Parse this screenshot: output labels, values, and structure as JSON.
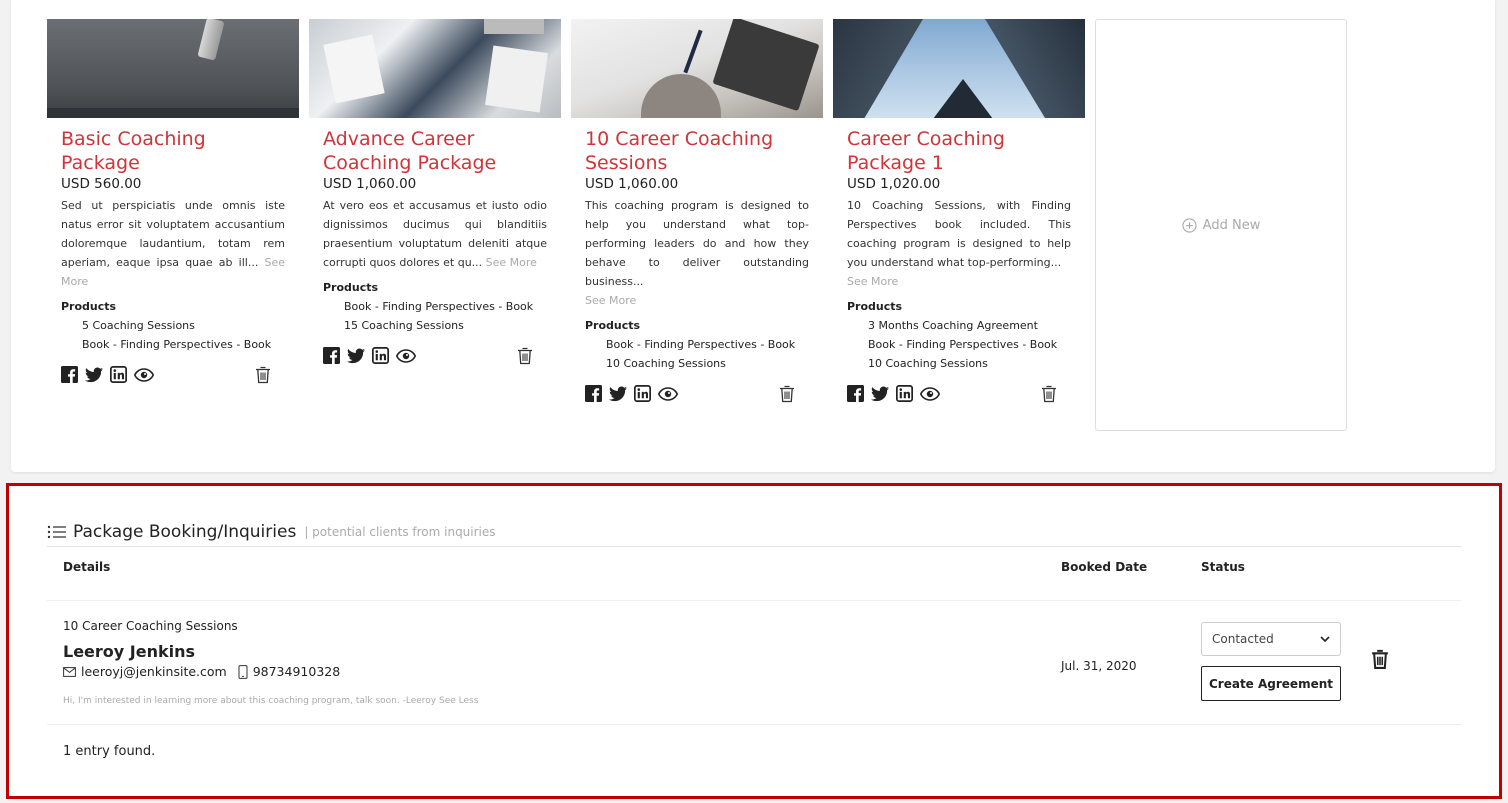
{
  "packages": [
    {
      "title": "Basic Coaching Package",
      "price": "USD 560.00",
      "description": "Sed ut perspiciatis unde omnis iste natus error sit voluptatem accusantium doloremque laudantium, totam rem aperiam, eaque ipsa quae ab ill...",
      "see_more": "See More",
      "products_heading": "Products",
      "products": [
        "5 Coaching Sessions",
        "Book - Finding Perspectives - Book"
      ]
    },
    {
      "title": "Advance Career Coaching Package",
      "price": "USD 1,060.00",
      "description": "At vero eos et accusamus et iusto odio dignissimos ducimus qui blanditiis praesentium voluptatum deleniti atque corrupti quos dolores et qu...",
      "see_more": "See More",
      "products_heading": "Products",
      "products": [
        "Book - Finding Perspectives - Book",
        "15 Coaching Sessions"
      ]
    },
    {
      "title": "10 Career Coaching Sessions",
      "price": "USD 1,060.00",
      "description": "This coaching program is designed to help you understand what top-performing leaders do and how they behave to deliver outstanding business...",
      "see_more": "See More",
      "products_heading": "Products",
      "products": [
        "Book - Finding Perspectives - Book",
        "10 Coaching Sessions"
      ]
    },
    {
      "title": "Career Coaching Package 1",
      "price": "USD 1,020.00",
      "description": "10 Coaching Sessions, with Finding Perspectives book included. This coaching program is designed to help you understand what top-performing...",
      "see_more": "See More",
      "products_heading": "Products",
      "products": [
        "3 Months Coaching Agreement",
        "Book - Finding Perspectives - Book",
        "10 Coaching Sessions"
      ]
    }
  ],
  "add_new_label": "Add New",
  "booking": {
    "title": "Package Booking/Inquiries",
    "subtitle": "| potential clients from inquiries",
    "columns": {
      "details": "Details",
      "booked_date": "Booked Date",
      "status": "Status"
    },
    "row": {
      "package": "10 Career Coaching Sessions",
      "client_name": "Leeroy Jenkins",
      "email": "leeroyj@jenkinsite.com",
      "phone": "98734910328",
      "message": "Hi, I'm interested in learning more about this coaching program, talk soon. -Leeroy",
      "see_less": "See Less",
      "booked_date": "Jul. 31, 2020",
      "status": "Contacted",
      "create_agreement": "Create Agreement"
    },
    "count": "1 entry found."
  },
  "colors": {
    "title_red": "#d13438",
    "highlight_border": "#c00000"
  }
}
